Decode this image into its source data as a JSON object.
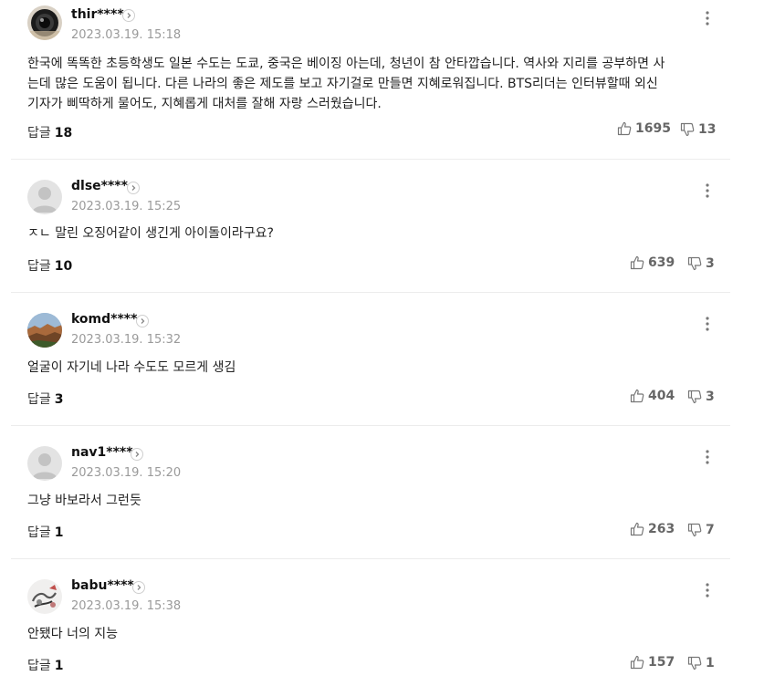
{
  "comments": [
    {
      "username": "thir****",
      "timestamp": "2023.03.19. 15:18",
      "avatar": "camera-lens",
      "lines": [
        "한국에 똑똑한 초등학생도 일본 수도는 도쿄, 중국은 베이징 아는데, 청년이 참 안타깝습니다. 역사와 지리를 공부하면 사",
        "는데 많은 도움이 됩니다. 다른 나라의 좋은 제도를 보고 자기걸로 만들면 지혜로워집니다. BTS리더는 인터뷰할때 외신",
        "기자가 삐딱하게 물어도, 지혜롭게 대처를 잘해 자랑 스러웠습니다."
      ],
      "reply_label": "답글",
      "reply_count": "18",
      "likes": "1695",
      "dislikes": "13"
    },
    {
      "username": "dlse****",
      "timestamp": "2023.03.19. 15:25",
      "avatar": "default",
      "lines": [
        "ㅈㄴ 말린 오징어같이 생긴게 아이돌이라구요?"
      ],
      "reply_label": "답글",
      "reply_count": "10",
      "likes": "639",
      "dislikes": "3"
    },
    {
      "username": "komd****",
      "timestamp": "2023.03.19. 15:32",
      "avatar": "landscape",
      "lines": [
        "얼굴이 자기네 나라 수도도 모르게 생김"
      ],
      "reply_label": "답글",
      "reply_count": "3",
      "likes": "404",
      "dislikes": "3"
    },
    {
      "username": "nav1****",
      "timestamp": "2023.03.19. 15:20",
      "avatar": "default",
      "lines": [
        "그냥 바보라서 그런듯"
      ],
      "reply_label": "답글",
      "reply_count": "1",
      "likes": "263",
      "dislikes": "7"
    },
    {
      "username": "babu****",
      "timestamp": "2023.03.19. 15:38",
      "avatar": "sketch",
      "lines": [
        "안됐다 너의 지능"
      ],
      "reply_label": "답글",
      "reply_count": "1",
      "likes": "157",
      "dislikes": "1"
    }
  ]
}
